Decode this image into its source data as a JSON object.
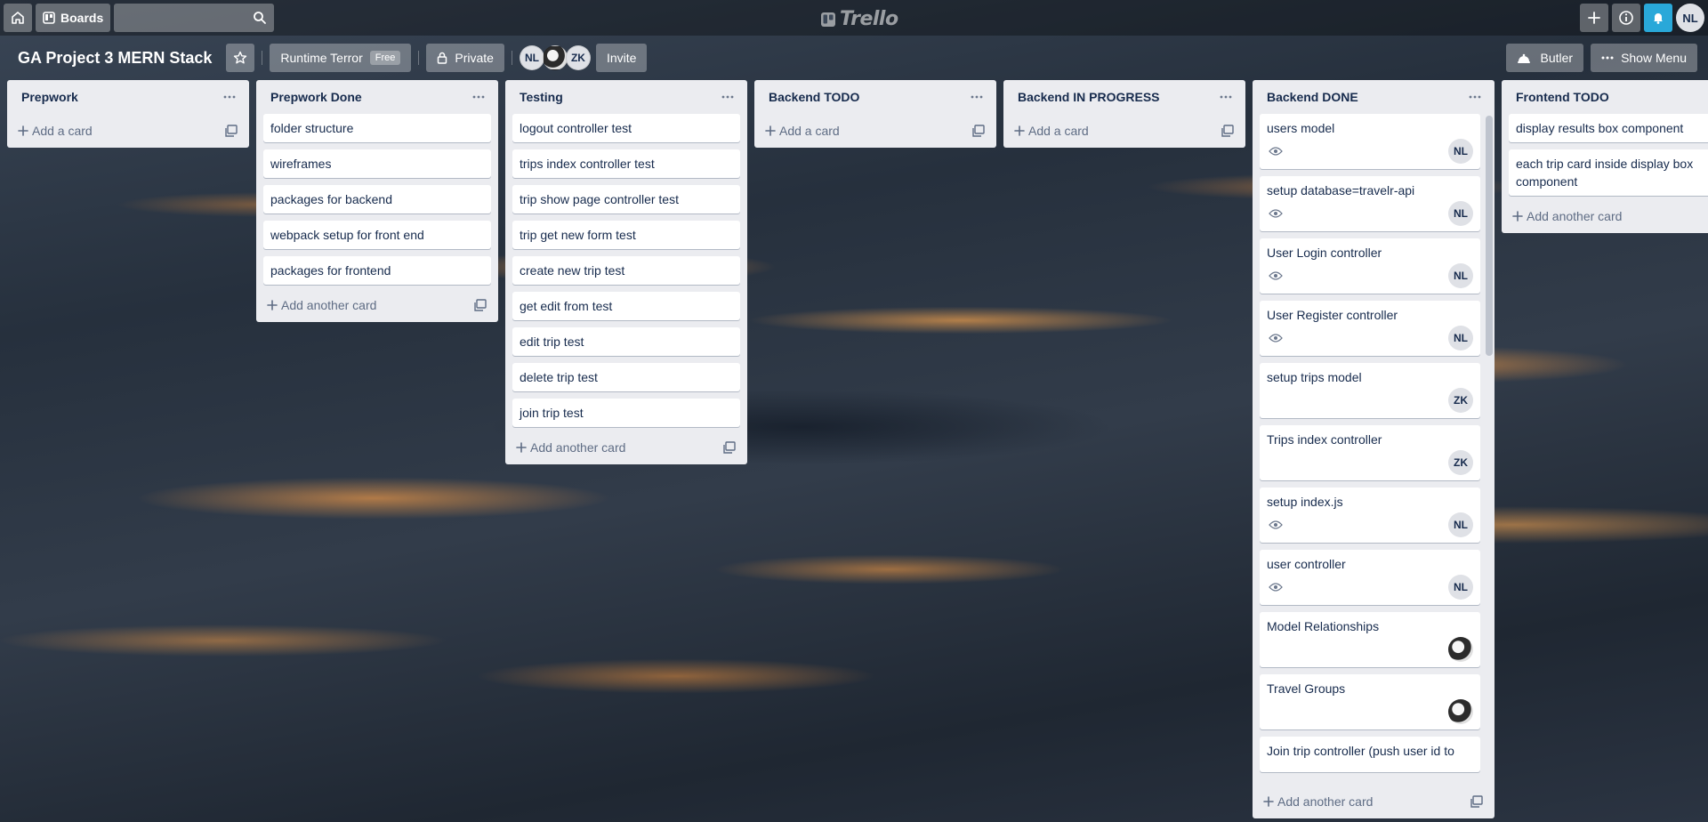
{
  "header": {
    "boards_label": "Boards",
    "search_placeholder": "",
    "logo_text": "Trello",
    "user_initials": "NL"
  },
  "board": {
    "title": "GA Project 3 MERN Stack",
    "team_name": "Runtime Terror",
    "team_badge": "Free",
    "visibility": "Private",
    "members": [
      "NL",
      "",
      "ZK"
    ],
    "invite_label": "Invite",
    "butler_label": "Butler",
    "menu_label": "Show Menu"
  },
  "lists": [
    {
      "title": "Prepwork",
      "cards": [],
      "add_label": "Add a card"
    },
    {
      "title": "Prepwork Done",
      "cards": [
        {
          "title": "folder structure"
        },
        {
          "title": "wireframes"
        },
        {
          "title": "packages for backend"
        },
        {
          "title": "webpack setup for front end"
        },
        {
          "title": "packages for frontend"
        }
      ],
      "add_label": "Add another card"
    },
    {
      "title": "Testing",
      "cards": [
        {
          "title": "logout controller test"
        },
        {
          "title": "trips index controller test"
        },
        {
          "title": "trip show page controller test"
        },
        {
          "title": "trip get new form test"
        },
        {
          "title": "create new trip test"
        },
        {
          "title": "get edit from test"
        },
        {
          "title": "edit trip test"
        },
        {
          "title": "delete trip test"
        },
        {
          "title": "join trip test"
        }
      ],
      "add_label": "Add another card"
    },
    {
      "title": "Backend TODO",
      "cards": [],
      "add_label": "Add a card"
    },
    {
      "title": "Backend IN PROGRESS",
      "cards": [],
      "add_label": "Add a card"
    },
    {
      "title": "Backend DONE",
      "cards": [
        {
          "title": "users model",
          "watch": true,
          "member": "NL"
        },
        {
          "title": "setup database=travelr-api",
          "watch": true,
          "member": "NL"
        },
        {
          "title": "User Login controller",
          "watch": true,
          "member": "NL"
        },
        {
          "title": "User Register controller",
          "watch": true,
          "member": "NL"
        },
        {
          "title": "setup trips model",
          "watch": false,
          "member": "ZK"
        },
        {
          "title": "Trips index controller",
          "watch": false,
          "member": "ZK"
        },
        {
          "title": "setup index.js",
          "watch": true,
          "member": "NL"
        },
        {
          "title": "user controller",
          "watch": true,
          "member": "NL"
        },
        {
          "title": "Model Relationships",
          "watch": false,
          "member": ""
        },
        {
          "title": "Travel Groups",
          "watch": false,
          "member": ""
        },
        {
          "title": "Join trip controller (push user id to",
          "watch": false,
          "member": null
        }
      ],
      "add_label": "Add another card"
    },
    {
      "title": "Frontend TODO",
      "cards": [
        {
          "title": "display results box component"
        },
        {
          "title": "each trip card inside display box component"
        }
      ],
      "add_label": "Add another card"
    }
  ]
}
